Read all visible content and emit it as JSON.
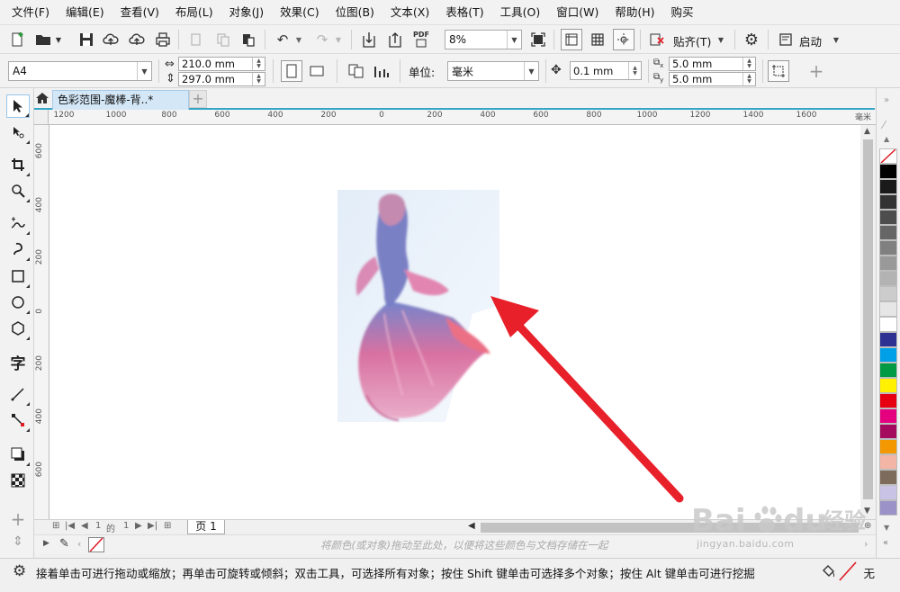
{
  "menubar": {
    "items": [
      "文件(F)",
      "编辑(E)",
      "查看(V)",
      "布局(L)",
      "对象(J)",
      "效果(C)",
      "位图(B)",
      "文本(X)",
      "表格(T)",
      "工具(O)",
      "窗口(W)",
      "帮助(H)",
      "购买"
    ]
  },
  "toolbar": {
    "zoom": "8%",
    "pdf_label": "PDF",
    "snap_label": "贴齐(T)",
    "launch_label": "启动"
  },
  "property_bar": {
    "page_size": "A4",
    "width": "210.0 mm",
    "height": "297.0 mm",
    "units_label": "单位:",
    "units_value": "毫米",
    "nudge": "0.1 mm",
    "dup_x": "5.0 mm",
    "dup_y": "5.0 mm",
    "dup_x_icon_label": "x",
    "dup_y_icon_label": "y"
  },
  "document": {
    "tab_title": "色彩范围-魔棒-背..*",
    "page_tab": "页 1",
    "page_counter_current": "1",
    "page_counter_of": "的",
    "page_counter_total": "1"
  },
  "rulers": {
    "horizontal_labels": [
      "1200",
      "1000",
      "800",
      "600",
      "400",
      "200",
      "0",
      "200",
      "400",
      "600",
      "800",
      "1000",
      "1200",
      "1400",
      "1600"
    ],
    "units": "毫米",
    "vertical_labels": [
      "600",
      "400",
      "200",
      "0",
      "200",
      "400",
      "600"
    ]
  },
  "document_palette": {
    "hint": "将颜色(或对象)拖动至此处，以便将这些颜色与文档存储在一起"
  },
  "palette": {
    "colors": [
      "#000000",
      "#1a1a1a",
      "#333333",
      "#4d4d4d",
      "#666666",
      "#808080",
      "#999999",
      "#b3b3b3",
      "#cccccc",
      "#e6e6e6",
      "#ffffff",
      "#2e3192",
      "#00a0e9",
      "#009944",
      "#fff100",
      "#e60012",
      "#e4007f",
      "#a40b5e",
      "#f39800",
      "#f2b5a6",
      "#7d6b5c",
      "#c9c3e6",
      "#9b93c8"
    ]
  },
  "status": {
    "message": "接着单击可进行拖动或缩放；再单击可旋转或倾斜；双击工具，可选择所有对象；按住 Shift 键单击可选择多个对象；按住 Alt 键单击可进行挖掘",
    "fill_none": "无"
  },
  "watermark": {
    "brand": "Baidu经验",
    "url": "jingyan.baidu.com"
  },
  "colors": {
    "annotation_arrow": "#e8202a",
    "tab_accent": "#35a6c8",
    "active_tab_bg": "#d4e7f7"
  }
}
